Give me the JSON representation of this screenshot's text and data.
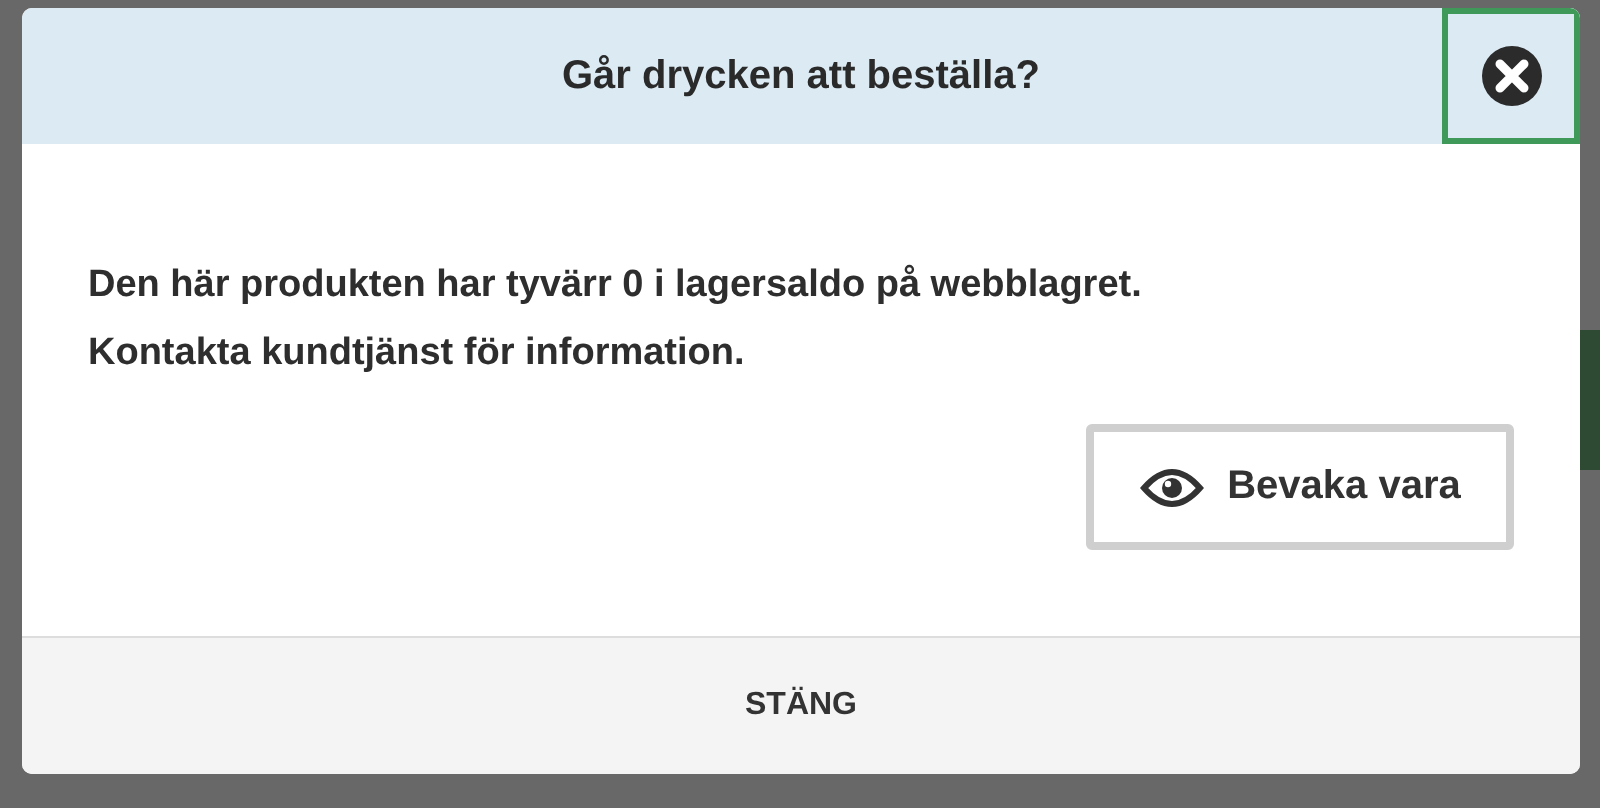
{
  "dialog": {
    "title": "Går drycken att beställa?",
    "message": "Den här produkten har tyvärr 0 i lagersaldo på webblagret.\nKontakta kundtjänst för information.",
    "watch_button": "Bevaka vara",
    "footer_button": "STÄNG"
  }
}
